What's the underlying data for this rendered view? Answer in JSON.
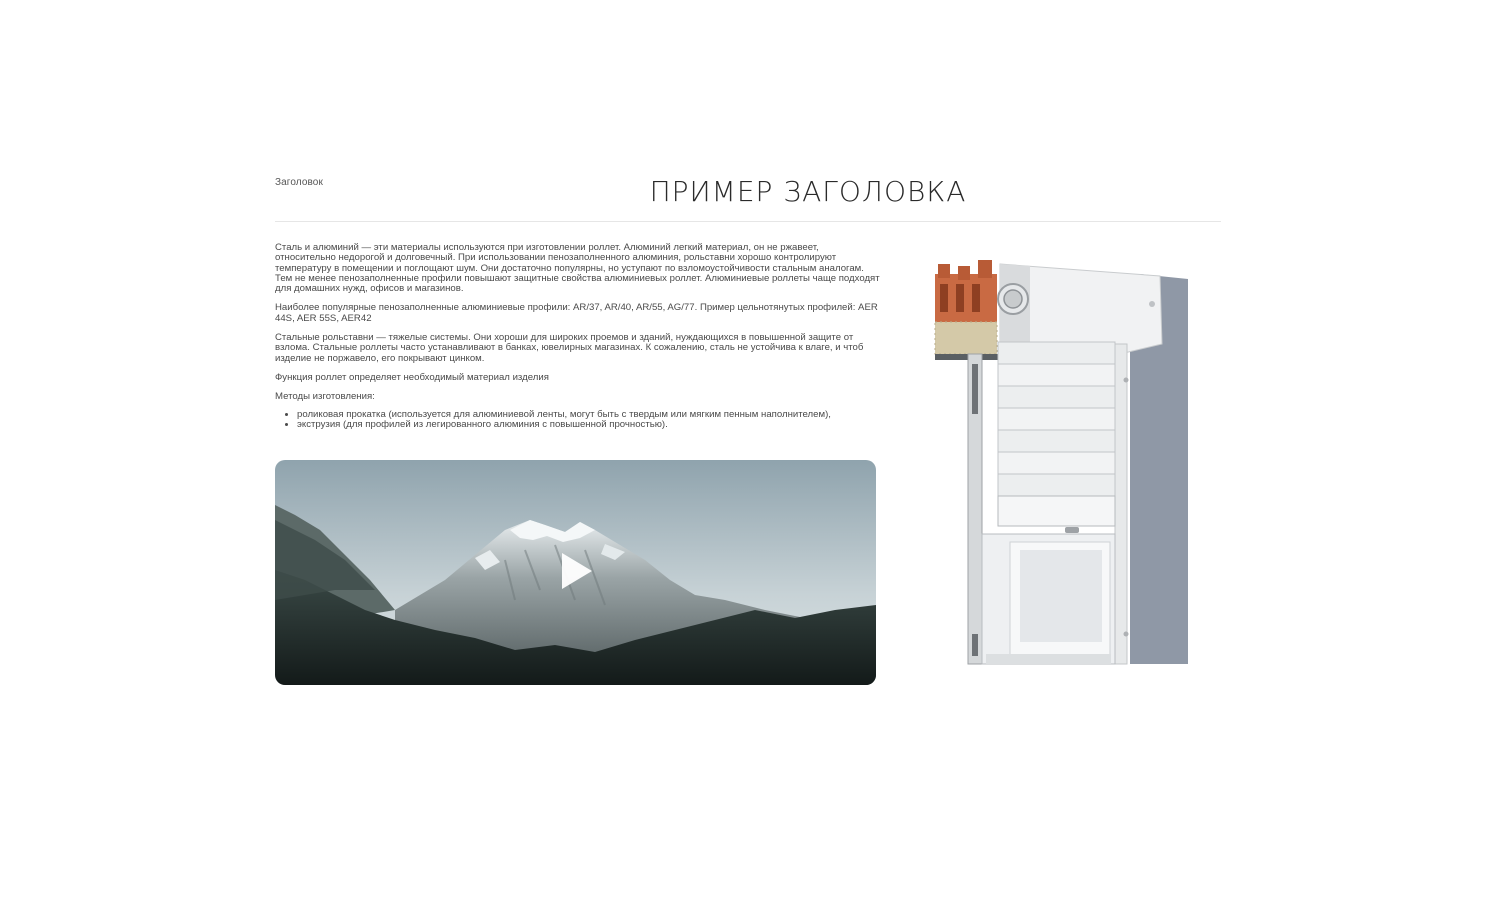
{
  "section": {
    "eyebrow": "Заголовок",
    "title": "ПРИМЕР ЗАГОЛОВКА"
  },
  "content": {
    "paragraphs": [
      "Сталь и алюминий — эти материалы используются при изготовлении роллет. Алюминий легкий материал, он не ржавеет, относительно недорогой и долговечный. При использовании пенозаполненного алюминия, рольставни хорошо контролируют температуру в помещении и поглощают шум. Они достаточно популярны, но уступают по взломоустойчивости стальным аналогам. Тем не менее пенозаполненные профили повышают защитные свойства алюминиевых роллет. Алюминиевые роллеты чаще подходят для домашних нужд, офисов и магазинов.",
      "Наиболее популярные пенозаполненные алюминиевые профили: AR/37, AR/40, AR/55, AG/77. Пример цельнотянутых профилей: AER 44S, AER 55S, AER42",
      "Стальные рольставни — тяжелые системы. Они хороши для широких проемов и зданий, нуждающихся в повышенной защите от взлома. Стальные роллеты часто устанавливают в банках, ювелирных магазинах. К сожалению, сталь не устойчива к влаге, и чтоб изделие не поржавело, его покрывают цинком.",
      "Функция роллет определяет необходимый материал изделия",
      "Методы изготовления:"
    ],
    "list": [
      "роликовая прокатка (используется для алюминиевой ленты, могут быть с твердым или мягким пенным наполнителем),",
      "экструзия (для профилей из легированного алюминия с повышенной прочностью)."
    ]
  },
  "video": {
    "play_icon": "play-icon"
  },
  "colors": {
    "text": "#4a4a4a",
    "title": "#2a2a2a",
    "divider": "#e6e6e6",
    "brick": "#c96a43",
    "wall": "#8f98a6"
  }
}
